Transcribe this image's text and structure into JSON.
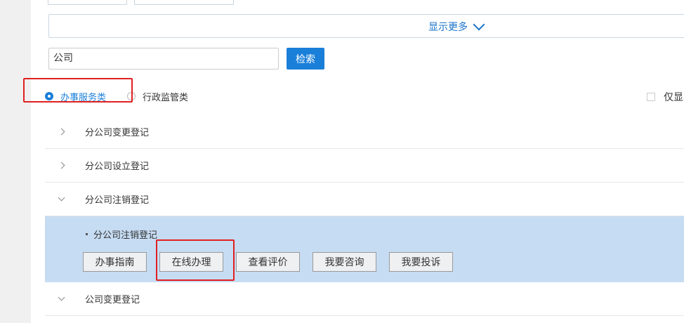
{
  "filters": {
    "show_more_label": "显示更多",
    "search_value": "公司",
    "search_button_label": "检索",
    "radio_options": [
      "办事服务类",
      "行政监管类"
    ],
    "only_checkbox_label": "仅显"
  },
  "items": [
    {
      "label": "分公司变更登记",
      "expanded": false
    },
    {
      "label": "分公司设立登记",
      "expanded": false
    },
    {
      "label": "分公司注销登记",
      "expanded": true
    },
    {
      "label": "公司变更登记",
      "expanded": false
    }
  ],
  "expanded_item": {
    "sub_title": "分公司注销登记",
    "actions": [
      "办事指南",
      "在线办理",
      "查看评价",
      "我要咨询",
      "我要投诉"
    ]
  },
  "colors": {
    "accent": "#1a7fd9",
    "expanded_bg": "#c6dcf3",
    "highlight": "#e02020"
  }
}
